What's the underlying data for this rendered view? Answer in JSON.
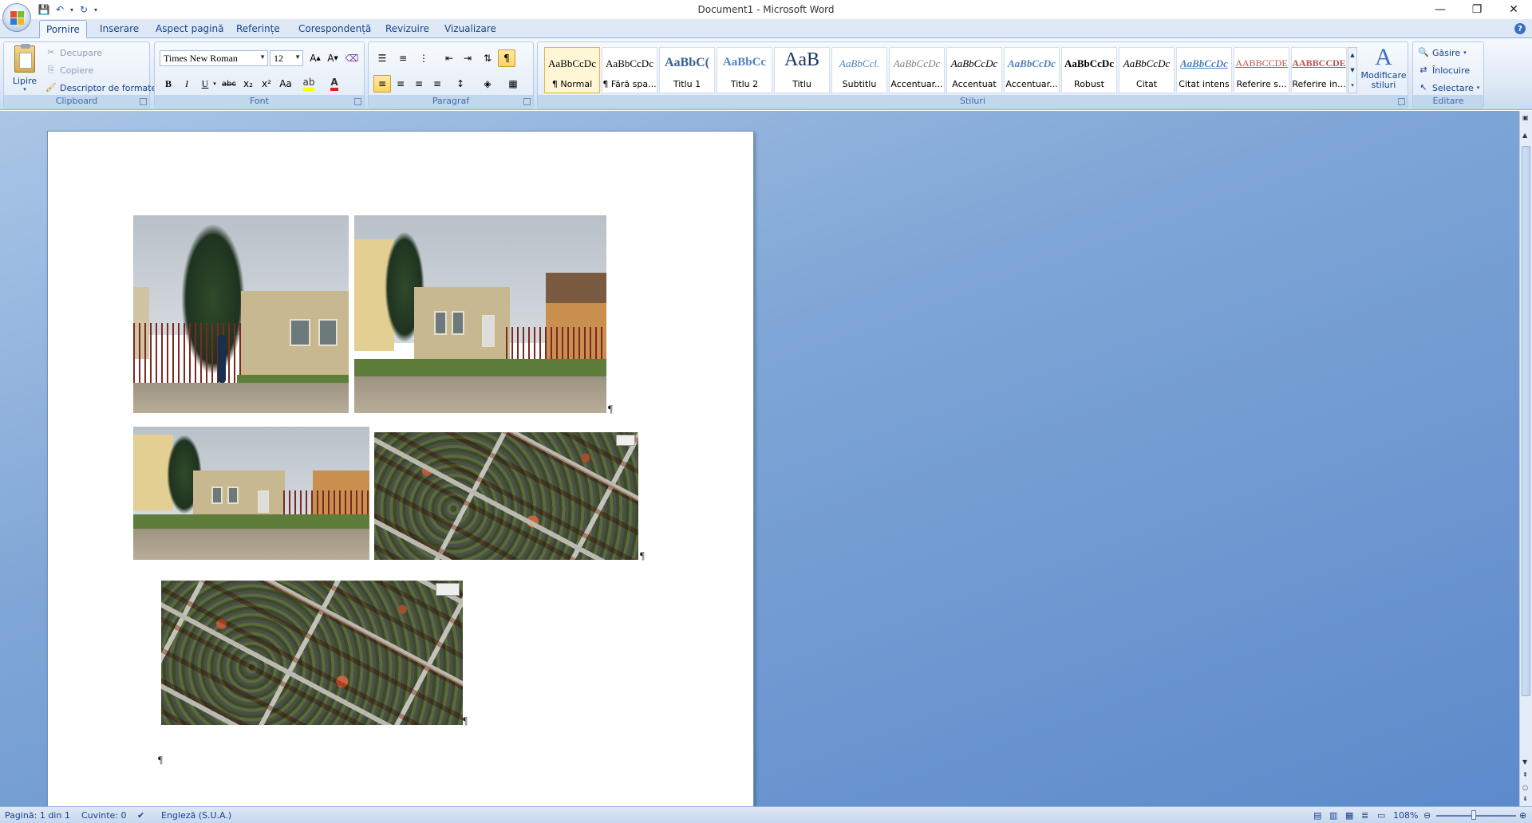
{
  "window": {
    "title": "Document1 - Microsoft Word",
    "controls": [
      "minimize",
      "restore",
      "close"
    ]
  },
  "quick_access": [
    "save-icon",
    "undo-icon",
    "redo-icon",
    "customize-icon"
  ],
  "tabs": [
    "Pornire",
    "Inserare",
    "Aspect pagină",
    "Referințe",
    "Corespondență",
    "Revizuire",
    "Vizualizare"
  ],
  "active_tab": "Pornire",
  "ribbon": {
    "clipboard": {
      "label": "Clipboard",
      "paste": "Lipire",
      "cut": "Decupare",
      "copy": "Copiere",
      "format_painter": "Descriptor de formate"
    },
    "font": {
      "label": "Font",
      "family": "Times New Roman",
      "size": "12",
      "bold": "B",
      "italic": "I",
      "underline": "U",
      "strike": "abc",
      "subscript": "x₂",
      "superscript": "x²",
      "change_case": "Aa"
    },
    "paragraph": {
      "label": "Paragraf"
    },
    "styles": {
      "label": "Stiluri",
      "items": [
        {
          "sample": "AaBbCcDc",
          "name": "¶ Normal",
          "selected": true
        },
        {
          "sample": "AaBbCcDc",
          "name": "¶ Fără spa..."
        },
        {
          "sample": "AaBbC(",
          "name": "Titlu 1"
        },
        {
          "sample": "AaBbCc",
          "name": "Titlu 2"
        },
        {
          "sample": "AaB",
          "name": "Titlu"
        },
        {
          "sample": "AaBbCcl.",
          "name": "Subtitlu"
        },
        {
          "sample": "AaBbCcDc",
          "name": "Accentuar..."
        },
        {
          "sample": "AaBbCcDc",
          "name": "Accentuat"
        },
        {
          "sample": "AaBbCcDc",
          "name": "Accentuar..."
        },
        {
          "sample": "AaBbCcDc",
          "name": "Robust"
        },
        {
          "sample": "AaBbCcDc",
          "name": "Citat"
        },
        {
          "sample": "AaBbCcDc",
          "name": "Citat intens"
        },
        {
          "sample": "AABBCCDE",
          "name": "Referire s..."
        },
        {
          "sample": "AABBCCDE",
          "name": "Referire in..."
        }
      ],
      "change_styles": "Modificare stiluri"
    },
    "editing": {
      "label": "Editare",
      "find": "Găsire",
      "replace": "Înlocuire",
      "select": "Selectare"
    }
  },
  "document": {
    "pilcrow": "¶"
  },
  "status": {
    "page": "Pagină: 1 din 1",
    "words": "Cuvinte: 0",
    "language": "Engleză (S.U.A.)",
    "zoom": "108%"
  },
  "colors": {
    "ribbon_accent": "#15428b",
    "workspace": "#6f97d0"
  }
}
